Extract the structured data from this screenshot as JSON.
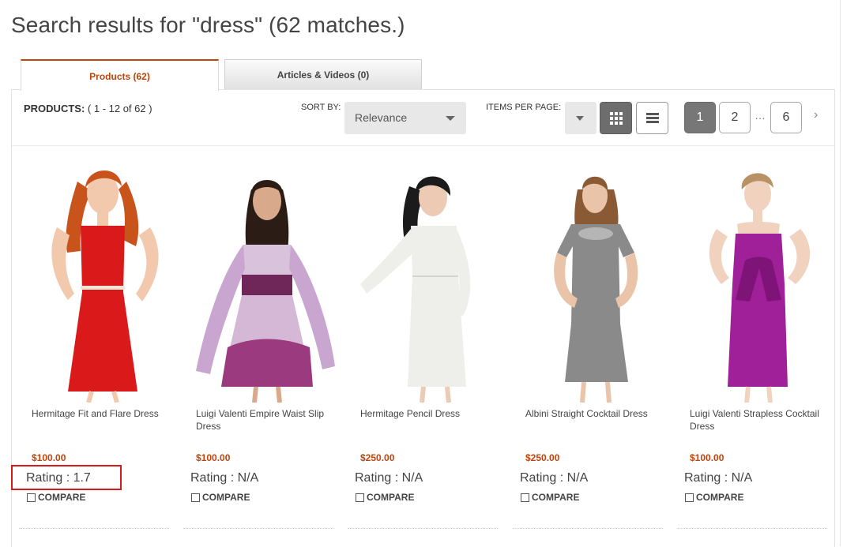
{
  "header": {
    "title": "Search results for \"dress\" (62 matches.)"
  },
  "tabs": [
    {
      "label": "Products (62)",
      "active": true
    },
    {
      "label": "Articles & Videos (0)",
      "active": false
    }
  ],
  "toolbar": {
    "products_label": "PRODUCTS:",
    "products_range": "( 1 - 12 of 62 )",
    "sort_label": "SORT BY:",
    "sort_value": "Relevance",
    "items_per_page_label": "ITEMS PER PAGE:",
    "items_per_page_value": "",
    "view_modes": [
      "grid-icon",
      "list-icon"
    ],
    "active_view": "grid"
  },
  "pagination": {
    "pages": [
      "1",
      "2",
      "6"
    ],
    "current": "1",
    "ellipsis": "…",
    "next_icon": "chevron-right-icon"
  },
  "products": [
    {
      "name": "Hermitage Fit and Flare Dress",
      "price": "$100.00",
      "rating": "Rating : 1.7",
      "compare_label": "COMPARE",
      "dress_color": "#d9191a",
      "highlighted": true
    },
    {
      "name": "Luigi Valenti Empire Waist Slip Dress",
      "price": "$100.00",
      "rating": "Rating : N/A",
      "compare_label": "COMPARE",
      "dress_color": "#9b3a7e",
      "highlighted": false
    },
    {
      "name": "Hermitage Pencil Dress",
      "price": "$250.00",
      "rating": "Rating : N/A",
      "compare_label": "COMPARE",
      "dress_color": "#eeeeea",
      "highlighted": false
    },
    {
      "name": "Albini Straight Cocktail Dress",
      "price": "$250.00",
      "rating": "Rating : N/A",
      "compare_label": "COMPARE",
      "dress_color": "#8a8a8a",
      "highlighted": false
    },
    {
      "name": "Luigi Valenti Strapless Cocktail Dress",
      "price": "$100.00",
      "rating": "Rating : N/A",
      "compare_label": "COMPARE",
      "dress_color": "#a0209a",
      "highlighted": false
    }
  ],
  "colors": {
    "accent": "#c0440b",
    "highlight": "#d61a1a",
    "active_page": "#777777"
  }
}
